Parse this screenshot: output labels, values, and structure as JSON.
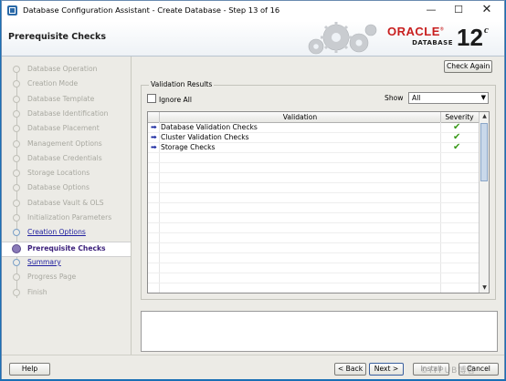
{
  "window": {
    "title": "Database Configuration Assistant - Create Database - Step 13 of 16",
    "minimize_glyph": "—",
    "maximize_glyph": "☐",
    "close_glyph": "✕"
  },
  "header": {
    "page_title": "Prerequisite Checks",
    "brand": "ORACLE",
    "registered": "®",
    "product": "DATABASE",
    "version": "12",
    "version_suffix": "c"
  },
  "nav": {
    "steps": [
      {
        "label": "Database Operation",
        "state": "pending"
      },
      {
        "label": "Creation Mode",
        "state": "pending"
      },
      {
        "label": "Database Template",
        "state": "pending"
      },
      {
        "label": "Database Identification",
        "state": "pending"
      },
      {
        "label": "Database Placement",
        "state": "pending"
      },
      {
        "label": "Management Options",
        "state": "pending"
      },
      {
        "label": "Database Credentials",
        "state": "pending"
      },
      {
        "label": "Storage Locations",
        "state": "pending"
      },
      {
        "label": "Database Options",
        "state": "pending"
      },
      {
        "label": "Database Vault & OLS",
        "state": "pending"
      },
      {
        "label": "Initialization Parameters",
        "state": "pending"
      },
      {
        "label": "Creation Options",
        "state": "done"
      },
      {
        "label": "Prerequisite Checks",
        "state": "current"
      },
      {
        "label": "Summary",
        "state": "done"
      },
      {
        "label": "Progress Page",
        "state": "pending"
      },
      {
        "label": "Finish",
        "state": "pending"
      }
    ]
  },
  "main": {
    "check_again_label": "Check Again",
    "group_title": "Validation Results",
    "ignore_all_label": "Ignore All",
    "show_label": "Show",
    "show_value": "All",
    "columns": {
      "validation": "Validation",
      "severity": "Severity"
    },
    "rows": [
      {
        "name": "Database Validation Checks",
        "severity_icon": "check-icon",
        "status_color": "#3a9a1a"
      },
      {
        "name": "Cluster Validation Checks",
        "severity_icon": "check-icon",
        "status_color": "#3a9a1a"
      },
      {
        "name": "Storage Checks",
        "severity_icon": "check-icon",
        "status_color": "#3a9a1a"
      }
    ]
  },
  "footer": {
    "help_label": "Help",
    "back_label": "< Back",
    "next_label": "Next >",
    "install_label": "Install",
    "cancel_label": "Cancel",
    "watermark": "©ITPUB博客"
  }
}
